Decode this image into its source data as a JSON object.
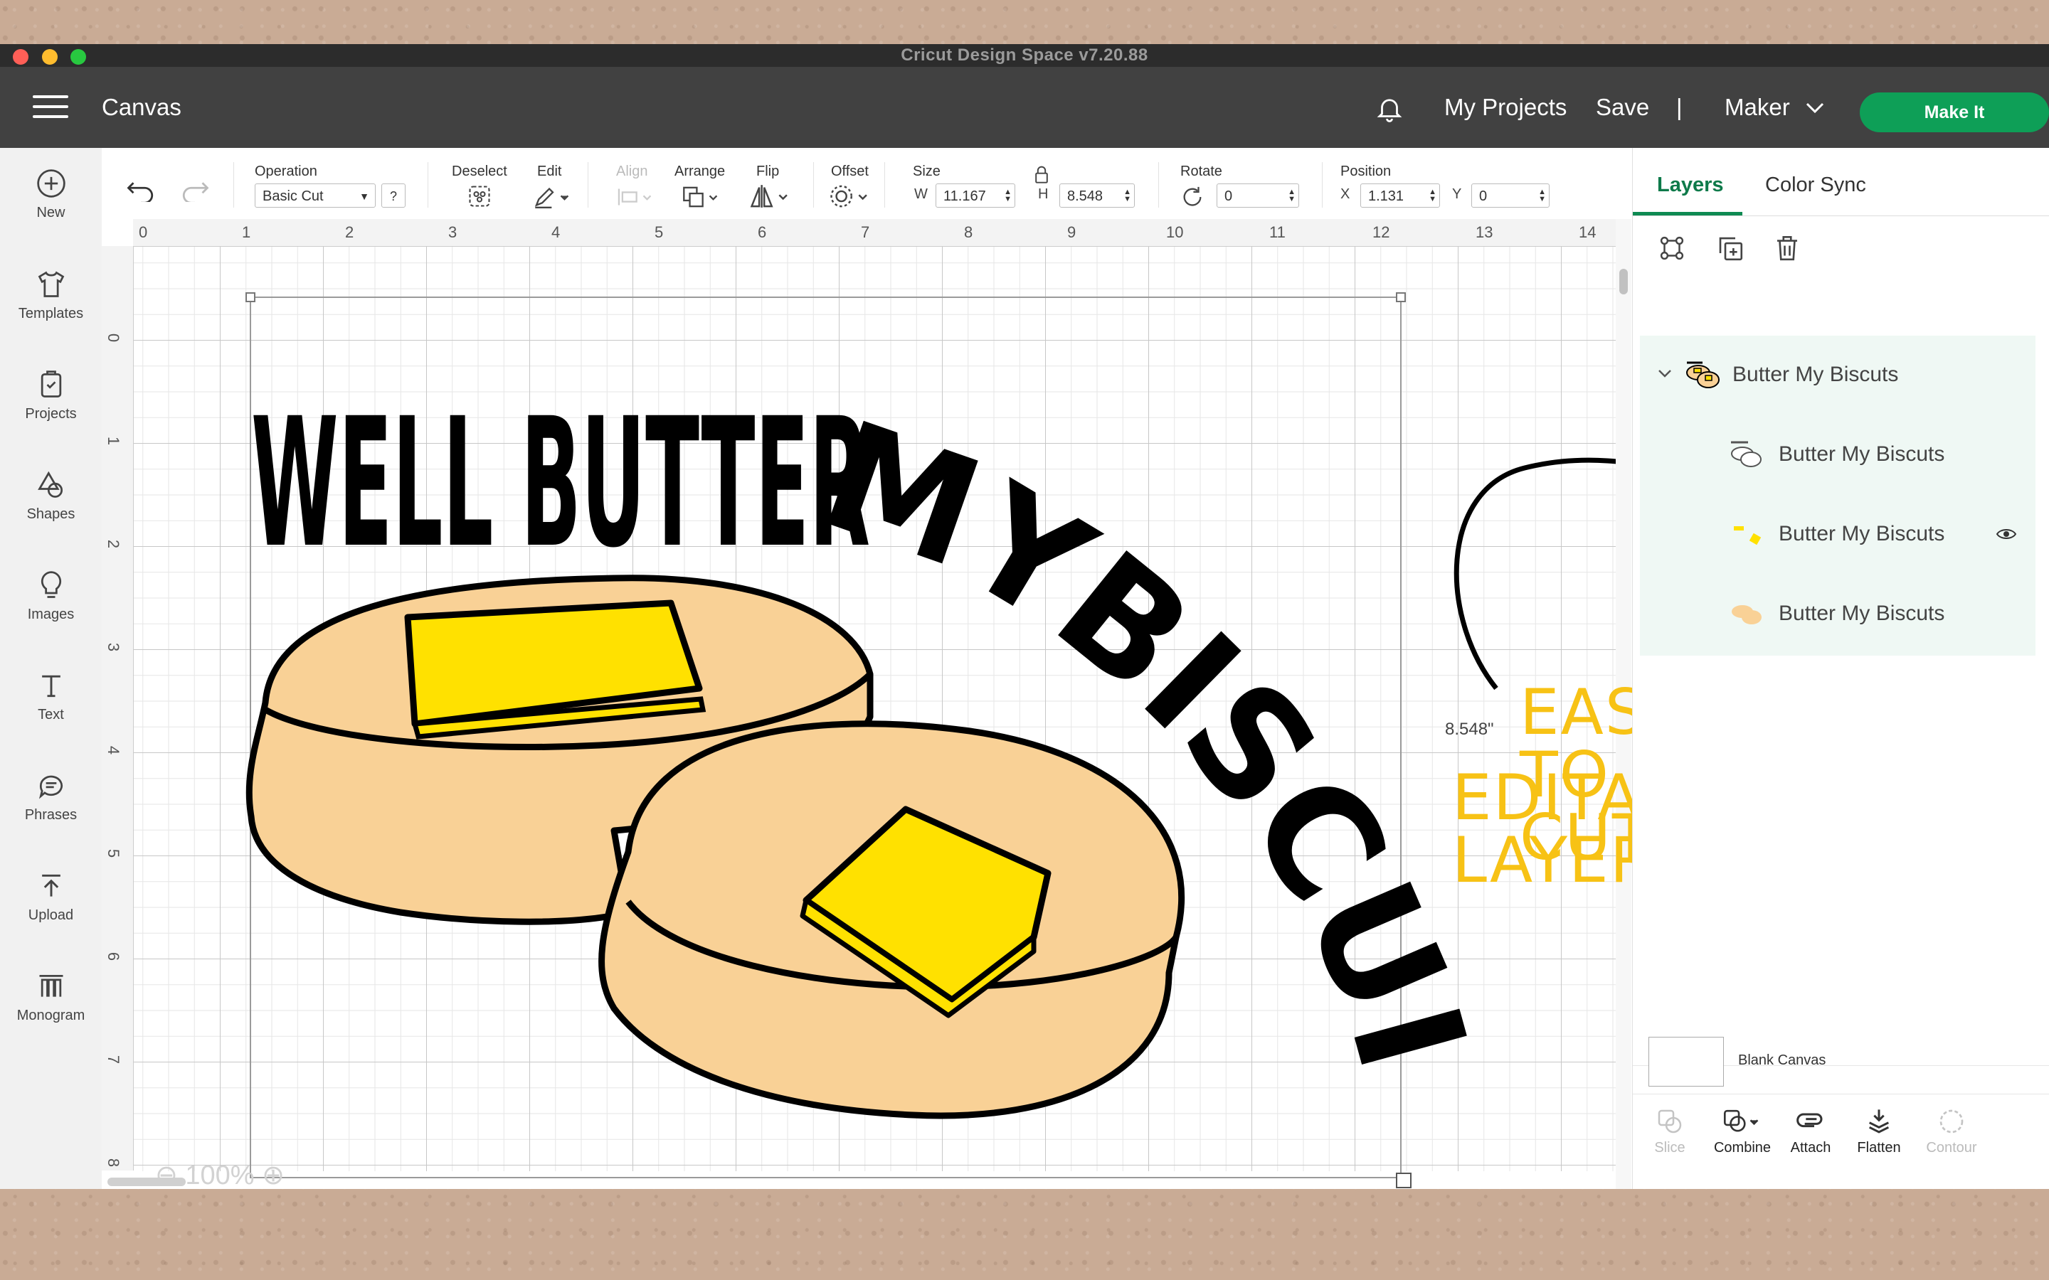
{
  "window": {
    "title": "Cricut Design Space  v7.20.88",
    "traffic_colors": [
      "#ff5f57",
      "#febc2e",
      "#28c840"
    ]
  },
  "header": {
    "canvas_label": "Canvas",
    "my_projects": "My Projects",
    "save": "Save",
    "divider": "|",
    "machine": "Maker",
    "make_it": "Make It",
    "accent": "#0e9f57"
  },
  "left_rail": {
    "items": [
      {
        "label": "New",
        "icon": "plus-circle-icon"
      },
      {
        "label": "Templates",
        "icon": "shirt-icon"
      },
      {
        "label": "Projects",
        "icon": "projects-icon"
      },
      {
        "label": "Shapes",
        "icon": "shapes-icon"
      },
      {
        "label": "Images",
        "icon": "lightbulb-icon"
      },
      {
        "label": "Text",
        "icon": "text-icon"
      },
      {
        "label": "Phrases",
        "icon": "speech-bubble-icon"
      },
      {
        "label": "Upload",
        "icon": "upload-icon"
      },
      {
        "label": "Monogram",
        "icon": "monogram-icon"
      }
    ]
  },
  "toolbar": {
    "operation_label": "Operation",
    "operation_value": "Basic Cut",
    "help": "?",
    "deselect_label": "Deselect",
    "edit_label": "Edit",
    "align_label": "Align",
    "arrange_label": "Arrange",
    "flip_label": "Flip",
    "offset_label": "Offset",
    "size_label": "Size",
    "w_label": "W",
    "w_value": "11.167",
    "h_label": "H",
    "h_value": "8.548",
    "rotate_label": "Rotate",
    "rotate_value": "0",
    "position_label": "Position",
    "x_label": "X",
    "x_value": "1.131",
    "y_label": "Y",
    "y_value": "0"
  },
  "rulers": {
    "top": [
      "0",
      "1",
      "2",
      "3",
      "4",
      "5",
      "6",
      "7",
      "8",
      "9",
      "10",
      "11",
      "12",
      "13",
      "14"
    ],
    "left": [
      "0",
      "1",
      "2",
      "3",
      "4",
      "5",
      "6",
      "7",
      "8"
    ]
  },
  "canvas": {
    "dimension_label": "8.548\"",
    "zoom": "100%",
    "artwork_text_top": "WELL BUTTER",
    "artwork_text_arc": "MYBISCUITS"
  },
  "annotation": {
    "line1": "EASY TO CUT",
    "line2": "EDITABLE LAYERS",
    "color": "#f7c215"
  },
  "right_panel": {
    "tabs": [
      "Layers",
      "Color Sync"
    ],
    "group_name": "Butter My Biscuts",
    "layers": [
      "Butter My Biscuts",
      "Butter My Biscuts",
      "Butter My Biscuts"
    ],
    "blank_canvas": "Blank Canvas",
    "bottom_actions": [
      {
        "label": "Slice",
        "enabled": false
      },
      {
        "label": "Combine",
        "enabled": true
      },
      {
        "label": "Attach",
        "enabled": true
      },
      {
        "label": "Flatten",
        "enabled": true
      },
      {
        "label": "Contour",
        "enabled": false
      }
    ]
  },
  "colors": {
    "biscuit": "#f9d196",
    "butter": "#ffe100",
    "header_bg": "#414141",
    "layer_highlight": "#eff8f4"
  }
}
